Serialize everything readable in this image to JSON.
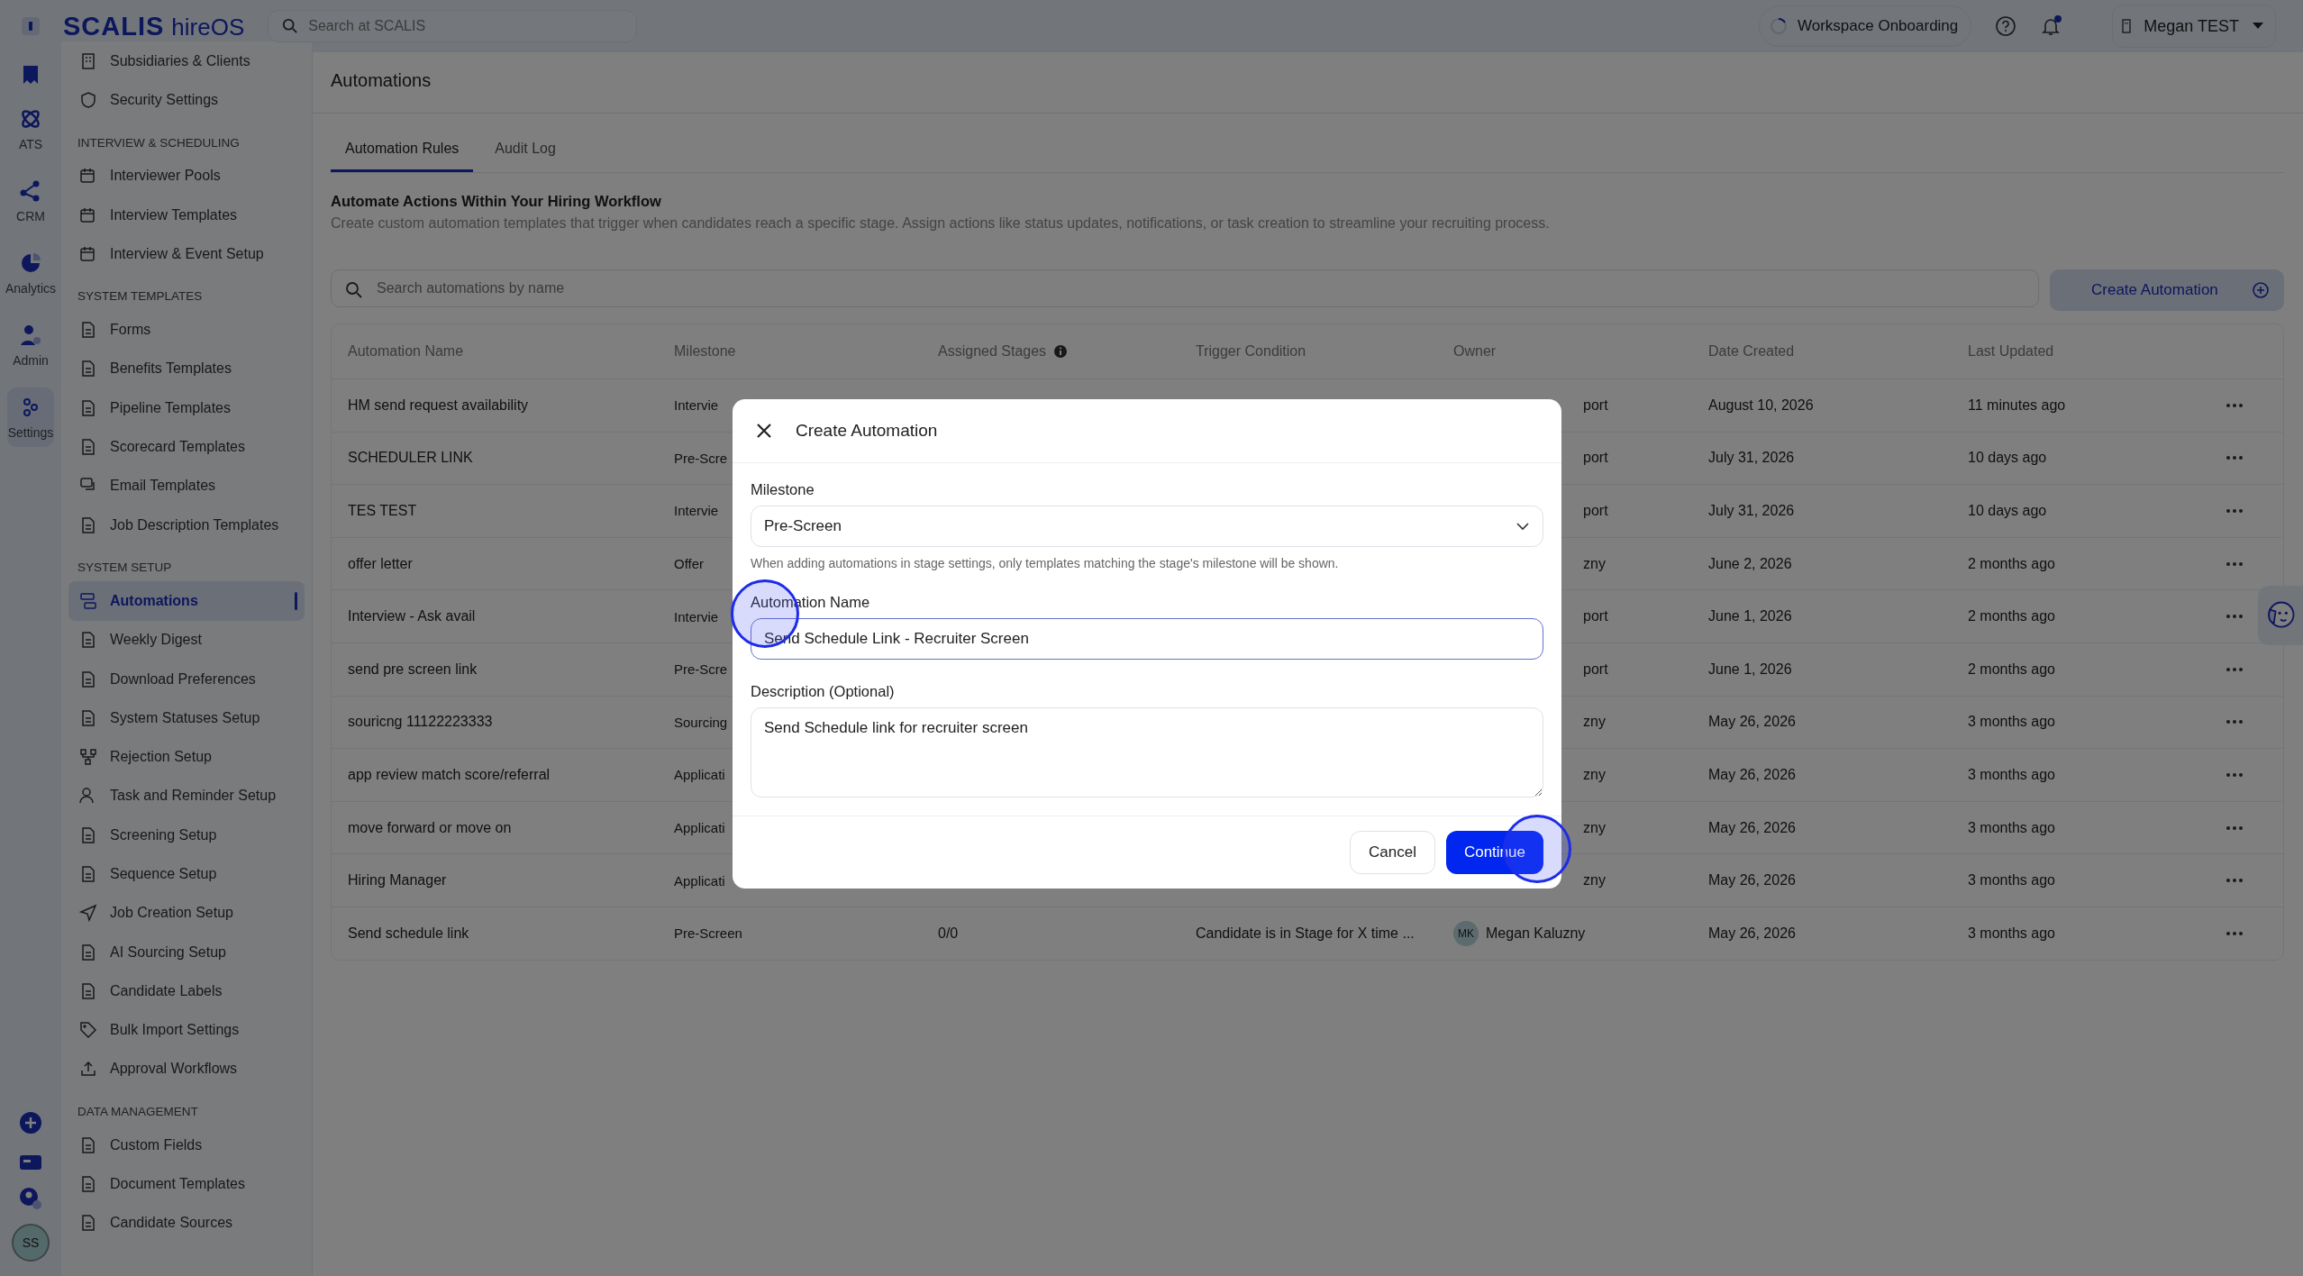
{
  "topbar": {
    "logo": "SCALIS",
    "product": "hireOS",
    "search_placeholder": "Search at SCALIS",
    "onboarding": "Workspace Onboarding",
    "user": "Megan TEST"
  },
  "rail": {
    "items": [
      {
        "label": "ATS",
        "selected": false
      },
      {
        "label": "CRM",
        "selected": false
      },
      {
        "label": "Analytics",
        "selected": false
      },
      {
        "label": "Admin",
        "selected": false
      },
      {
        "label": "Settings",
        "selected": true
      }
    ],
    "avatar": "SS"
  },
  "sidebar": {
    "sections": [
      {
        "items": [
          {
            "label": "Subsidiaries & Clients",
            "selected": false
          },
          {
            "label": "Security Settings",
            "selected": false
          }
        ]
      },
      {
        "title": "INTERVIEW & SCHEDULING",
        "items": [
          {
            "label": "Interviewer Pools",
            "selected": false
          },
          {
            "label": "Interview Templates",
            "selected": false
          },
          {
            "label": "Interview & Event Setup",
            "selected": false
          }
        ]
      },
      {
        "title": "SYSTEM TEMPLATES",
        "items": [
          {
            "label": "Forms",
            "selected": false
          },
          {
            "label": "Benefits Templates",
            "selected": false
          },
          {
            "label": "Pipeline Templates",
            "selected": false
          },
          {
            "label": "Scorecard Templates",
            "selected": false
          },
          {
            "label": "Email Templates",
            "selected": false
          },
          {
            "label": "Job Description Templates",
            "selected": false
          }
        ]
      },
      {
        "title": "SYSTEM SETUP",
        "items": [
          {
            "label": "Automations",
            "selected": true
          },
          {
            "label": "Weekly Digest",
            "selected": false
          },
          {
            "label": "Download Preferences",
            "selected": false
          },
          {
            "label": "System Statuses Setup",
            "selected": false
          },
          {
            "label": "Rejection Setup",
            "selected": false
          },
          {
            "label": "Task and Reminder Setup",
            "selected": false
          },
          {
            "label": "Screening Setup",
            "selected": false
          },
          {
            "label": "Sequence Setup",
            "selected": false
          },
          {
            "label": "Job Creation Setup",
            "selected": false
          },
          {
            "label": "AI Sourcing Setup",
            "selected": false
          },
          {
            "label": "Candidate Labels",
            "selected": false
          },
          {
            "label": "Bulk Import Settings",
            "selected": false
          },
          {
            "label": "Approval Workflows",
            "selected": false
          }
        ]
      },
      {
        "title": "DATA MANAGEMENT",
        "items": [
          {
            "label": "Custom Fields",
            "selected": false
          },
          {
            "label": "Document Templates",
            "selected": false
          },
          {
            "label": "Candidate Sources",
            "selected": false
          }
        ]
      }
    ]
  },
  "page": {
    "title": "Automations",
    "tabs": [
      {
        "label": "Automation Rules",
        "selected": true
      },
      {
        "label": "Audit Log",
        "selected": false
      }
    ],
    "heading": "Automate Actions Within Your Hiring Workflow",
    "description": "Create custom automation templates that trigger when candidates reach a specific stage. Assign actions like status updates, notifications, or task creation to streamline your recruiting process.",
    "search_placeholder": "Search automations by name",
    "create_button": "Create Automation"
  },
  "table": {
    "columns": [
      "Automation Name",
      "Milestone",
      "Assigned Stages",
      "Trigger Condition",
      "Owner",
      "Date Created",
      "Last Updated"
    ],
    "rows": [
      {
        "name": "HM send request availability",
        "milestone": "Intervie",
        "owner": "port",
        "date": "August 10, 2026",
        "updated": "11 minutes ago"
      },
      {
        "name": "SCHEDULER LINK",
        "milestone": "Pre-Scre",
        "owner": "port",
        "date": "July 31, 2026",
        "updated": "10 days ago"
      },
      {
        "name": "TES TEST",
        "milestone": "Intervie",
        "owner": "port",
        "date": "July 31, 2026",
        "updated": "10 days ago"
      },
      {
        "name": "offer letter",
        "milestone": "Offer",
        "owner": "zny",
        "date": "June 2, 2026",
        "updated": "2 months ago"
      },
      {
        "name": "Interview - Ask avail",
        "milestone": "Intervie",
        "owner": "port",
        "date": "June 1, 2026",
        "updated": "2 months ago"
      },
      {
        "name": "send pre screen link",
        "milestone": "Pre-Scre",
        "owner": "port",
        "date": "June 1, 2026",
        "updated": "2 months ago"
      },
      {
        "name": "souricng 11122223333",
        "milestone": "Sourcing",
        "owner": "zny",
        "date": "May 26, 2026",
        "updated": "3 months ago"
      },
      {
        "name": "app review match score/referral",
        "milestone": "Applicati",
        "owner": "zny",
        "date": "May 26, 2026",
        "updated": "3 months ago"
      },
      {
        "name": "move forward or move on",
        "milestone": "Applicati",
        "owner": "zny",
        "date": "May 26, 2026",
        "updated": "3 months ago"
      },
      {
        "name": "Hiring Manager",
        "milestone": "Applicati",
        "owner": "zny",
        "date": "May 26, 2026",
        "updated": "3 months ago"
      },
      {
        "name": "Send schedule link",
        "milestone": "Pre-Screen",
        "stages": "0/0",
        "trigger": "Candidate is in Stage for X time ...",
        "owner_initials": "MK",
        "owner": "Megan Kaluzny",
        "date": "May 26, 2026",
        "updated": "3 months ago"
      }
    ]
  },
  "modal": {
    "title": "Create Automation",
    "milestone_label": "Milestone",
    "milestone_value": "Pre-Screen",
    "hint": "When adding automations in stage settings, only templates matching the stage's milestone will be shown.",
    "name_label": "Automation Name",
    "name_value": "Send Schedule Link - Recruiter Screen",
    "description_label": "Description (Optional)",
    "description_value": "Send Schedule link for recruiter screen",
    "cancel": "Cancel",
    "continue": "Continue"
  }
}
